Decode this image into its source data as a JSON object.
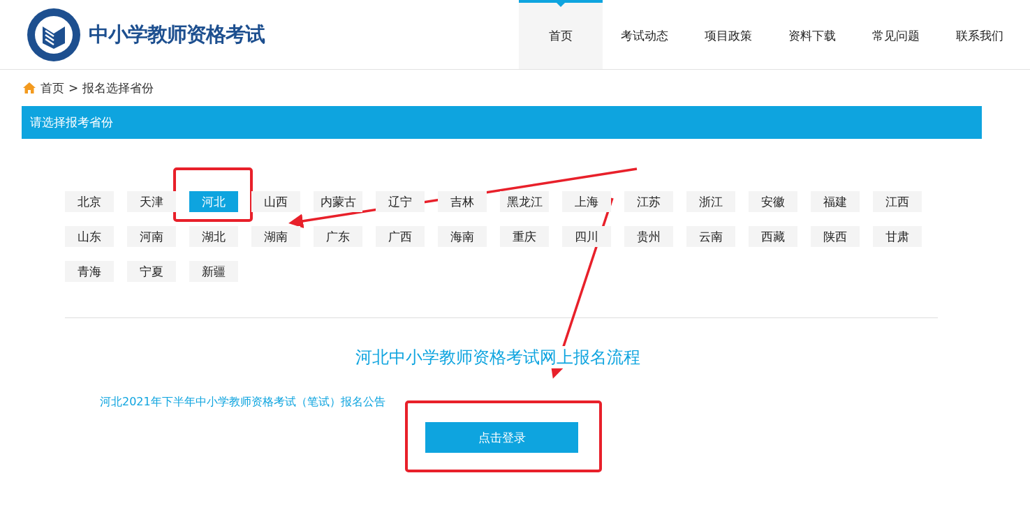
{
  "logo": {
    "title": "中小学教师资格考试"
  },
  "nav": [
    {
      "label": "首页",
      "selected": true
    },
    {
      "label": "考试动态",
      "selected": false
    },
    {
      "label": "项目政策",
      "selected": false
    },
    {
      "label": "资料下载",
      "selected": false
    },
    {
      "label": "常见问题",
      "selected": false
    },
    {
      "label": "联系我们",
      "selected": false
    }
  ],
  "breadcrumb": {
    "home": "首页",
    "separator": ">",
    "current": "报名选择省份"
  },
  "section_title": "请选择报考省份",
  "provinces": [
    {
      "label": "北京",
      "selected": false
    },
    {
      "label": "天津",
      "selected": false
    },
    {
      "label": "河北",
      "selected": true
    },
    {
      "label": "山西",
      "selected": false
    },
    {
      "label": "内蒙古",
      "selected": false
    },
    {
      "label": "辽宁",
      "selected": false
    },
    {
      "label": "吉林",
      "selected": false
    },
    {
      "label": "黑龙江",
      "selected": false
    },
    {
      "label": "上海",
      "selected": false
    },
    {
      "label": "江苏",
      "selected": false
    },
    {
      "label": "浙江",
      "selected": false
    },
    {
      "label": "安徽",
      "selected": false
    },
    {
      "label": "福建",
      "selected": false
    },
    {
      "label": "江西",
      "selected": false
    },
    {
      "label": "山东",
      "selected": false
    },
    {
      "label": "河南",
      "selected": false
    },
    {
      "label": "湖北",
      "selected": false
    },
    {
      "label": "湖南",
      "selected": false
    },
    {
      "label": "广东",
      "selected": false
    },
    {
      "label": "广西",
      "selected": false
    },
    {
      "label": "海南",
      "selected": false
    },
    {
      "label": "重庆",
      "selected": false
    },
    {
      "label": "四川",
      "selected": false
    },
    {
      "label": "贵州",
      "selected": false
    },
    {
      "label": "云南",
      "selected": false
    },
    {
      "label": "西藏",
      "selected": false
    },
    {
      "label": "陕西",
      "selected": false
    },
    {
      "label": "甘肃",
      "selected": false
    },
    {
      "label": "青海",
      "selected": false
    },
    {
      "label": "宁夏",
      "selected": false
    },
    {
      "label": "新疆",
      "selected": false
    }
  ],
  "process_title": "河北中小学教师资格考试网上报名流程",
  "notice_link": "河北2021年下半年中小学教师资格考试（笔试）报名公告",
  "login_button": "点击登录"
}
